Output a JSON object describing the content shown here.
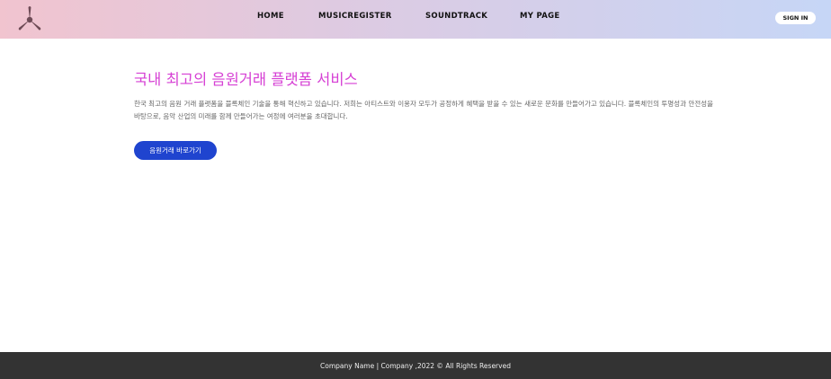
{
  "header": {
    "logo_icon": "tri-blade-logo-icon",
    "nav": [
      {
        "label": "HOME"
      },
      {
        "label": "MUSICREGISTER"
      },
      {
        "label": "SOUNDTRACK"
      },
      {
        "label": "MY PAGE"
      }
    ],
    "signin_label": "SIGN IN"
  },
  "hero": {
    "title": "국내 최고의 음원거래 플랫폼 서비스",
    "description": "한국 최고의 음원 거래 플랫폼을 블록체인 기술을 통해 혁신하고 있습니다. 저희는 아티스트와 이용자 모두가 공정하게 혜택을 받을 수 있는 새로운 문화를 만들어가고 있습니다. 블록체인의 투명성과 안전성을 바탕으로, 음악 산업의 미래를 함께 만들어가는 여정에 여러분을 초대합니다.",
    "cta_label": "음원거래 바로가기"
  },
  "footer": {
    "text": "Company Name | Company ,2022 © All Rights Reserved"
  },
  "colors": {
    "header_gradient_start": "#f1c4cf",
    "header_gradient_end": "#c6d6f6",
    "title": "#d63fd4",
    "cta": "#1f44cf",
    "footer_bg": "#333333"
  }
}
